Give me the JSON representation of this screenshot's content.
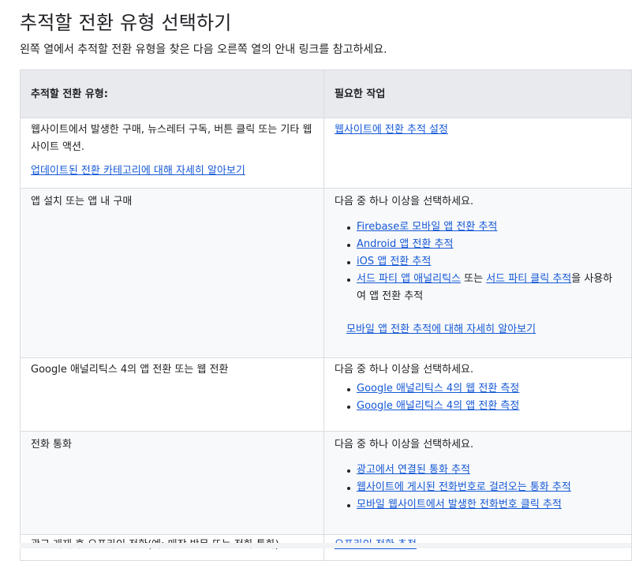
{
  "title": "추적할 전환 유형 선택하기",
  "intro": "왼쪽 열에서 추적할 전환 유형을 찾은 다음 오른쪽 열의 안내 링크를 참고하세요.",
  "table": {
    "headers": [
      "추적할 전환 유형:",
      "필요한 작업"
    ],
    "rows": [
      {
        "type": "웹사이트에서 발생한 구매, 뉴스레터 구독, 버튼 클릭 또는 기타 웹사이트 액션.",
        "type_link": "업데이트된 전환 카테고리에 대해 자세히 알아보기",
        "action_link": "웹사이트에 전환 추적 설정"
      },
      {
        "type": "앱 설치 또는 앱 내 구매",
        "action_intro": "다음 중 하나 이상을 선택하세요.",
        "items": [
          "Firebase로 모바일 앱 전환 추적",
          "Android 앱 전환 추적",
          "iOS 앱 전환 추적"
        ],
        "item4": {
          "link1": "서드 파티 앱 애널리틱스",
          "text1": " 또는 ",
          "link2": "서드 파티 클릭 추적",
          "text2": "을 사용하여 앱 전환 추적"
        },
        "more_link": "모바일 앱 전환 추적에 대해 자세히 알아보기"
      },
      {
        "type": "Google 애널리틱스 4의 앱 전환 또는 웹 전환",
        "action_intro": "다음 중 하나 이상을 선택하세요.",
        "items": [
          "Google 애널리틱스 4의 웹 전환 측정",
          "Google 애널리틱스 4의 앱 전환 측정"
        ]
      },
      {
        "type": "전화 통화",
        "action_intro": "다음 중 하나 이상을 선택하세요.",
        "items": [
          "광고에서 연결된 통화 추적",
          "웹사이트에 게시된 전화번호로 걸려오는 통화 추적",
          "모바일 웹사이트에서 발생한 전화번호 클릭 추적"
        ]
      },
      {
        "type": "광고 게재 후 오프라인 전환(예: 매장 방문 또는 전화 통화)",
        "action_link": "오프라인 전환 추적"
      }
    ]
  }
}
